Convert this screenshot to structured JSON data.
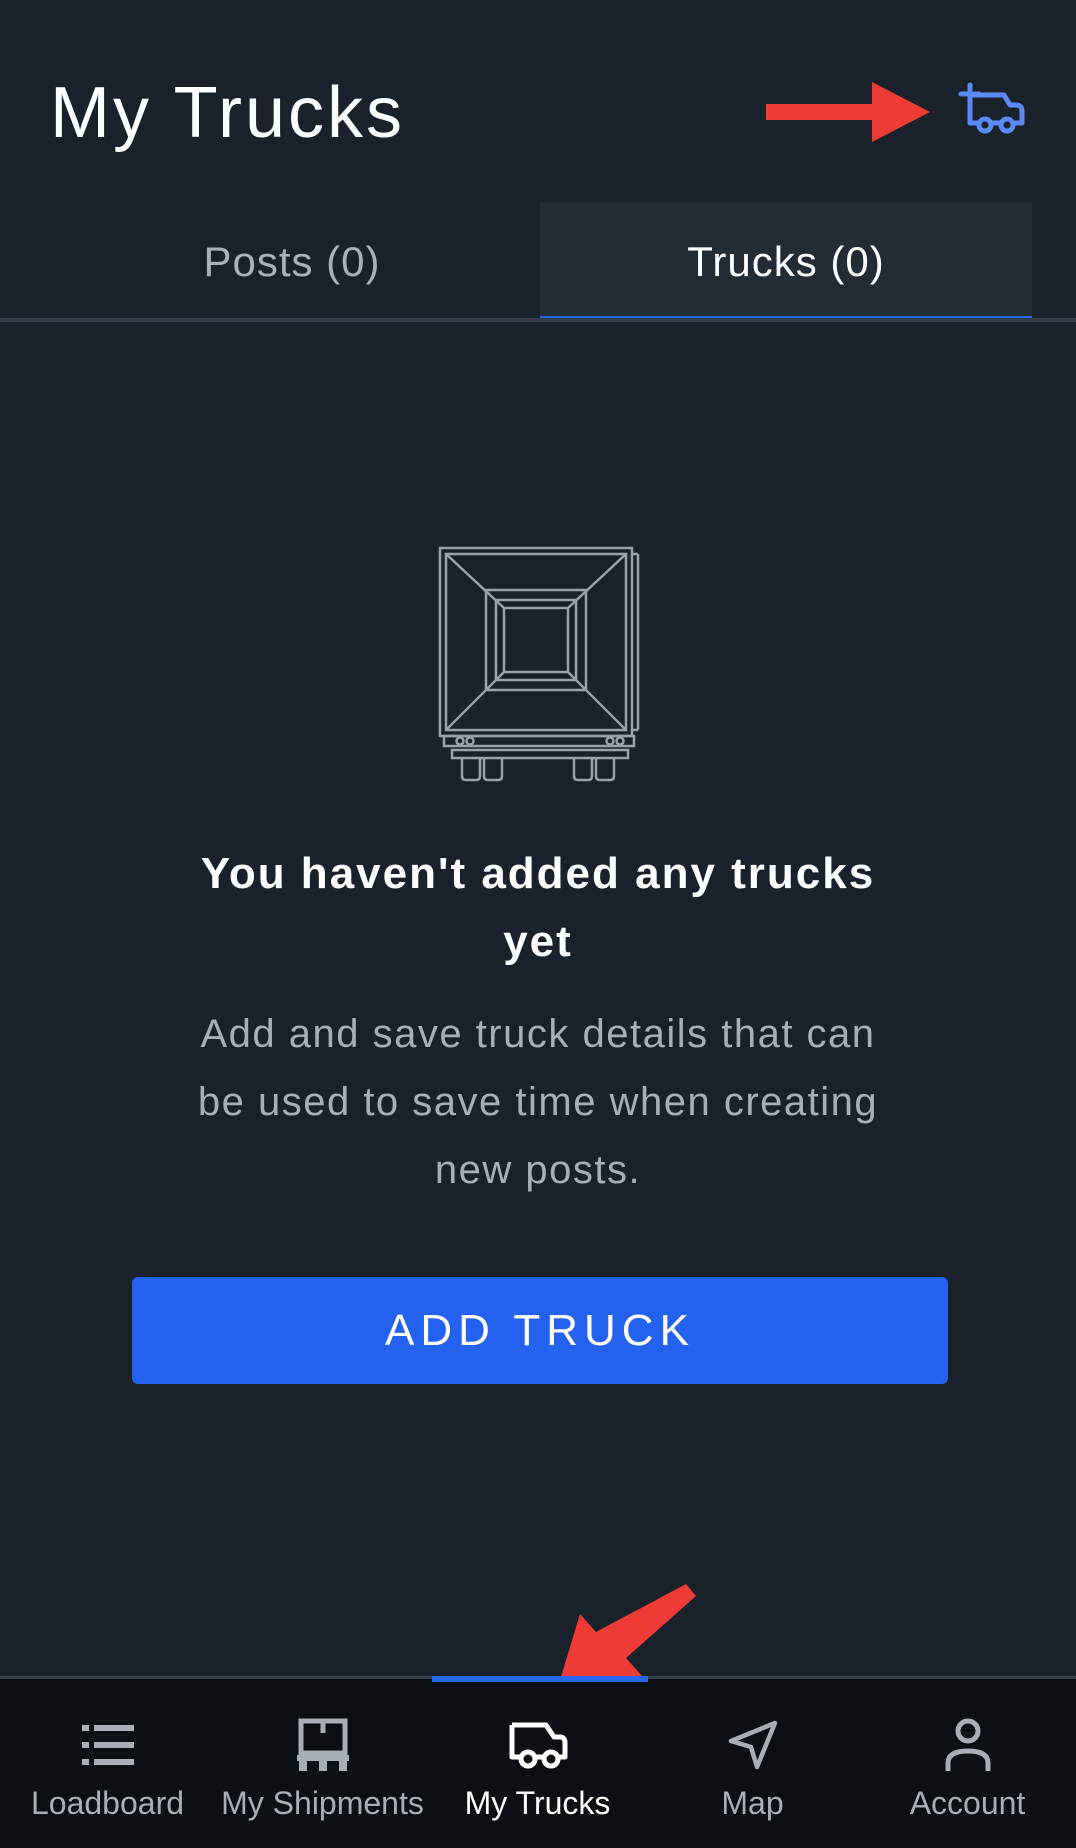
{
  "header": {
    "title": "My Trucks",
    "add_truck_icon": "truck-plus-icon"
  },
  "tabs": [
    {
      "label": "Posts (0)",
      "active": false
    },
    {
      "label": "Trucks (0)",
      "active": true
    }
  ],
  "empty_state": {
    "illustration_icon": "empty-trailer-icon",
    "title": "You haven't added any trucks yet",
    "description": "Add and save truck details that can be used to save time when creating new posts.",
    "button_label": "ADD TRUCK"
  },
  "bottom_nav": {
    "items": [
      {
        "label": "Loadboard",
        "icon": "list-icon",
        "active": false
      },
      {
        "label": "My Shipments",
        "icon": "pallet-icon",
        "active": false
      },
      {
        "label": "My Trucks",
        "icon": "truck-icon",
        "active": true
      },
      {
        "label": "Map",
        "icon": "navigation-arrow-icon",
        "active": false
      },
      {
        "label": "Account",
        "icon": "person-icon",
        "active": false
      }
    ]
  },
  "colors": {
    "background": "#1b212a",
    "accent": "#2361ee",
    "annotation_arrow": "#ee3b36",
    "nav_background": "#0c0f13"
  }
}
